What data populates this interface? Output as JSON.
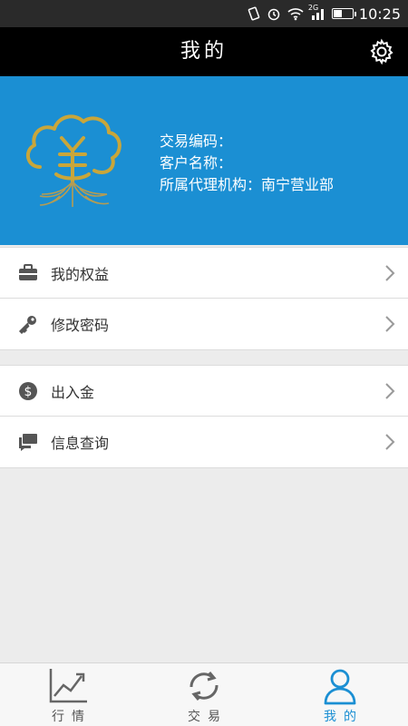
{
  "status_bar": {
    "time": "10:25",
    "network": "2G"
  },
  "header": {
    "title": "我的"
  },
  "profile": {
    "trade_code": "交易编码：",
    "customer_name": "客户名称：",
    "agency": "所属代理机构：南宁营业部"
  },
  "menu": {
    "group1": [
      {
        "label": "我的权益",
        "icon": "briefcase-icon"
      },
      {
        "label": "修改密码",
        "icon": "key-icon"
      }
    ],
    "group2": [
      {
        "label": "出入金",
        "icon": "dollar-icon"
      },
      {
        "label": "信息查询",
        "icon": "chat-icon"
      }
    ]
  },
  "bottom_nav": [
    {
      "label": "行情",
      "icon": "chart-icon",
      "active": false
    },
    {
      "label": "交易",
      "icon": "refresh-icon",
      "active": false
    },
    {
      "label": "我的",
      "icon": "user-icon",
      "active": true
    }
  ],
  "colors": {
    "accent": "#1b8fd3",
    "header_bg": "#000000",
    "status_bg": "#2a2a2a",
    "logo_gold": "#c9a63a"
  }
}
